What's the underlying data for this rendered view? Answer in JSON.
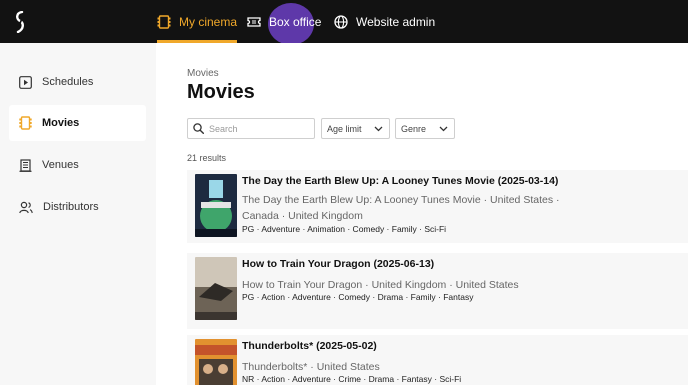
{
  "topnav": {
    "items": [
      {
        "label": "My cinema",
        "icon": "film-icon"
      },
      {
        "label": "Box office",
        "icon": "ticket-icon"
      },
      {
        "label": "Website admin",
        "icon": "globe-icon"
      }
    ]
  },
  "sidebar": {
    "items": [
      {
        "label": "Schedules",
        "icon": "play-square-icon"
      },
      {
        "label": "Movies",
        "icon": "film-strip-icon"
      },
      {
        "label": "Venues",
        "icon": "building-icon"
      },
      {
        "label": "Distributors",
        "icon": "people-icon"
      }
    ]
  },
  "main": {
    "breadcrumb": "Movies",
    "title": "Movies",
    "search_placeholder": "Search",
    "filters": {
      "age": "Age limit",
      "genre": "Genre"
    },
    "results": "21 results",
    "movies": [
      {
        "title": "The Day the Earth Blew Up: A Looney Tunes Movie (2025-03-14)",
        "subtitle": "The Day the Earth Blew Up: A Looney Tunes Movie · United States · Canada · United Kingdom",
        "tags": "PG · Adventure · Animation · Comedy · Family · Sci-Fi"
      },
      {
        "title": "How to Train Your Dragon (2025-06-13)",
        "subtitle": "How to Train Your Dragon · United Kingdom · United States",
        "tags": "PG · Action · Adventure · Comedy · Drama · Family · Fantasy"
      },
      {
        "title": "Thunderbolts* (2025-05-02)",
        "subtitle": "Thunderbolts* · United States",
        "tags": "NR · Action · Adventure · Crime · Drama · Fantasy · Sci-Fi"
      }
    ]
  },
  "colors": {
    "accent": "#f0a82a",
    "topbar": "#121212",
    "sidebar": "#f7f7f7"
  }
}
